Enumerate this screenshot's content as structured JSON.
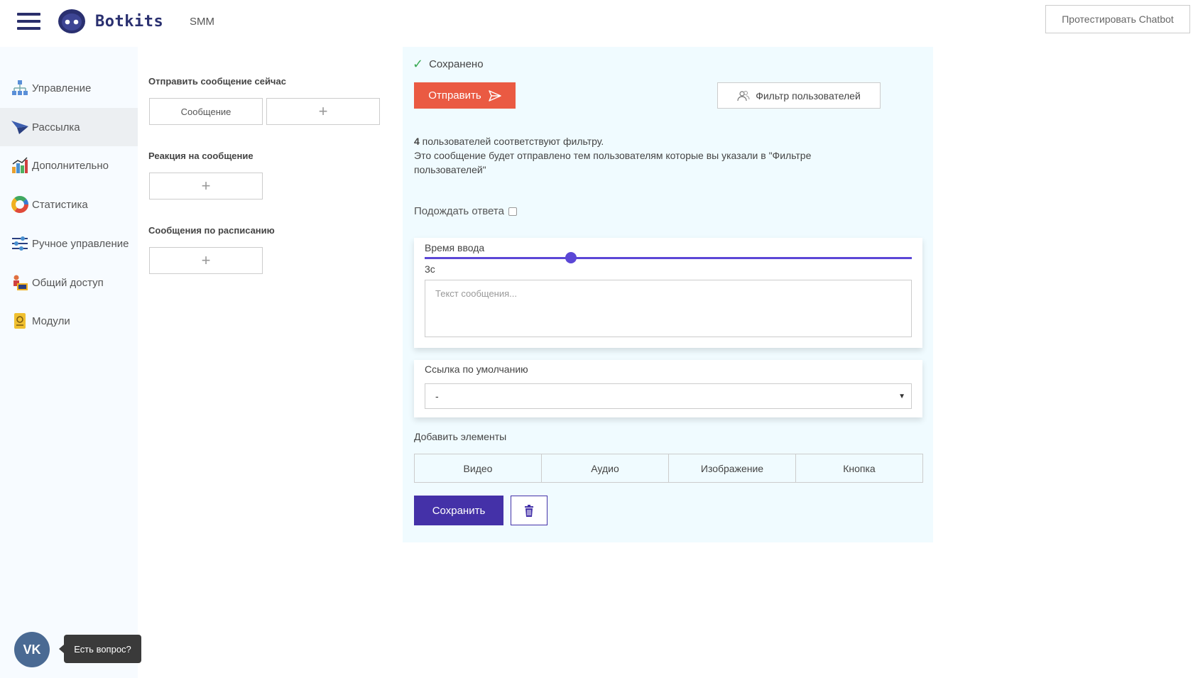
{
  "header": {
    "brand": "Botkits",
    "crumb": "SMM",
    "test_button": "Протестировать Chatbot"
  },
  "sidebar": {
    "items": [
      {
        "label": "Управление",
        "icon": "hierarchy-icon",
        "active": false
      },
      {
        "label": "Рассылка",
        "icon": "paper-plane-icon",
        "active": true
      },
      {
        "label": "Дополнительно",
        "icon": "bar-chart-icon",
        "active": false
      },
      {
        "label": "Статистика",
        "icon": "donut-chart-icon",
        "active": false
      },
      {
        "label": "Ручное управление",
        "icon": "sliders-icon",
        "active": false
      },
      {
        "label": "Общий доступ",
        "icon": "shared-access-icon",
        "active": false
      },
      {
        "label": "Модули",
        "icon": "modules-icon",
        "active": false
      }
    ]
  },
  "middle": {
    "send_now_title": "Отправить сообщение сейчас",
    "message_box": "Сообщение",
    "reaction_title": "Реакция на сообщение",
    "scheduled_title": "Сообщения по расписанию",
    "plus": "+"
  },
  "editor": {
    "saved_text": "Сохранено",
    "send_button": "Отправить",
    "filter_button": "Фильтр пользователей",
    "info_count": "4",
    "info_line1_rest": " пользователей соответствуют фильтру.",
    "info_line2": "Это сообщение будет отправлено тем пользователям которые вы указали в \"Фильтре пользователей\"",
    "wait_label": "Подождать ответа",
    "wait_checked": false,
    "time_label": "Время ввода",
    "time_value": "3с",
    "slider_fraction": 0.3,
    "textarea_placeholder": "Текст сообщения...",
    "link_label": "Ссылка по умолчанию",
    "link_selected": "-",
    "add_elements_label": "Добавить элементы",
    "element_buttons": [
      "Видео",
      "Аудио",
      "Изображение",
      "Кнопка"
    ],
    "save_button": "Сохранить"
  },
  "support": {
    "vk_label": "VK",
    "question": "Есть вопрос?"
  },
  "colors": {
    "brand": "#2a3070",
    "accent": "#4431a8",
    "send": "#ea5a42",
    "slider": "#5b47d6",
    "panel_bg": "#f0fbff"
  }
}
